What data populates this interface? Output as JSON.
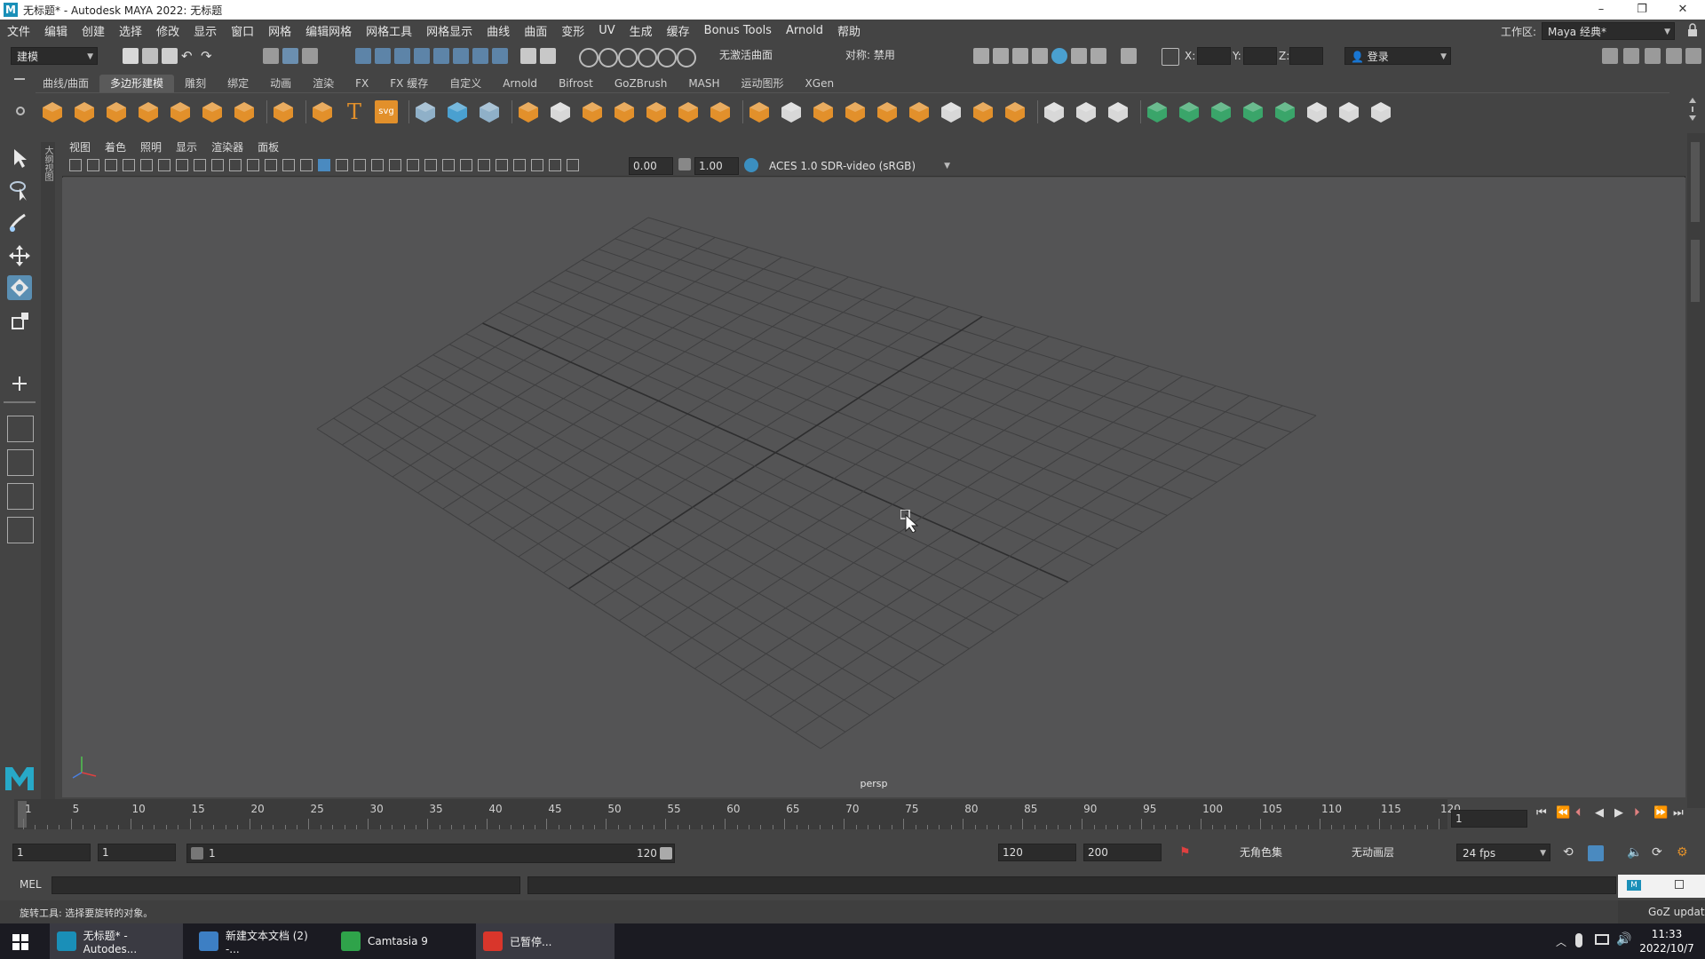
{
  "window": {
    "title": "无标题* - Autodesk MAYA 2022: 无标题",
    "logo": "M",
    "controls": [
      "–",
      "❐",
      "✕"
    ]
  },
  "menubar": [
    "文件",
    "编辑",
    "创建",
    "选择",
    "修改",
    "显示",
    "窗口",
    "网格",
    "编辑网格",
    "网格工具",
    "网格显示",
    "曲线",
    "曲面",
    "变形",
    "UV",
    "生成",
    "缓存",
    "Bonus Tools",
    "Arnold",
    "帮助"
  ],
  "workspace": {
    "label": "工作区:",
    "value": "Maya 经典*"
  },
  "statusline": {
    "mode": "建模",
    "live_surface": "无激活曲面",
    "symmetry": "对称: 禁用",
    "x_label": "X:",
    "y_label": "Y:",
    "z_label": "Z:",
    "login": "登录"
  },
  "shelf_tabs": [
    "曲线/曲面",
    "多边形建模",
    "雕刻",
    "绑定",
    "动画",
    "渲染",
    "FX",
    "FX 缓存",
    "自定义",
    "Arnold",
    "Bifrost",
    "GoZBrush",
    "MASH",
    "运动图形",
    "XGen"
  ],
  "active_shelf": 1,
  "viewport": {
    "menu": [
      "视图",
      "着色",
      "照明",
      "显示",
      "渲染器",
      "面板"
    ],
    "exposure": "0.00",
    "gamma": "1.00",
    "color_space": "ACES 1.0 SDR-video (sRGB)",
    "camera": "persp",
    "side_label": "大纲视图"
  },
  "timeline": {
    "ticks": [
      "1",
      "5",
      "10",
      "15",
      "20",
      "25",
      "30",
      "35",
      "40",
      "45",
      "50",
      "55",
      "60",
      "65",
      "70",
      "75",
      "80",
      "85",
      "90",
      "95",
      "100",
      "105",
      "110",
      "115",
      "120"
    ],
    "current_frame": "1"
  },
  "range": {
    "start": "1",
    "playback_start": "1",
    "slider_start": "1",
    "slider_end": "120",
    "playback_end": "120",
    "end": "200",
    "character_set": "无角色集",
    "anim_layer": "无动画层",
    "fps": "24 fps"
  },
  "cmdline": {
    "label": "MEL"
  },
  "helpline": {
    "text": "旋转工具: 选择要旋转的对象。"
  },
  "goz": {
    "text": "GoZ updat"
  },
  "taskbar": {
    "items": [
      {
        "label": "无标题* - Autodes...",
        "color": "#1a8fb8"
      },
      {
        "label": "新建文本文档 (2) -...",
        "color": "#3d7fc4"
      },
      {
        "label": "Camtasia 9",
        "color": "#2fa34a"
      },
      {
        "label": "已暂停...",
        "color": "#d9362b"
      }
    ],
    "time": "11:33",
    "date": "2022/10/7"
  },
  "colors": {
    "active_tool": "#5a8fb3",
    "shelf_orange": "#e2902b",
    "shelf_green": "#3aa56a",
    "viewport_bg": "#545455",
    "grid_line": "#3f3f40"
  }
}
